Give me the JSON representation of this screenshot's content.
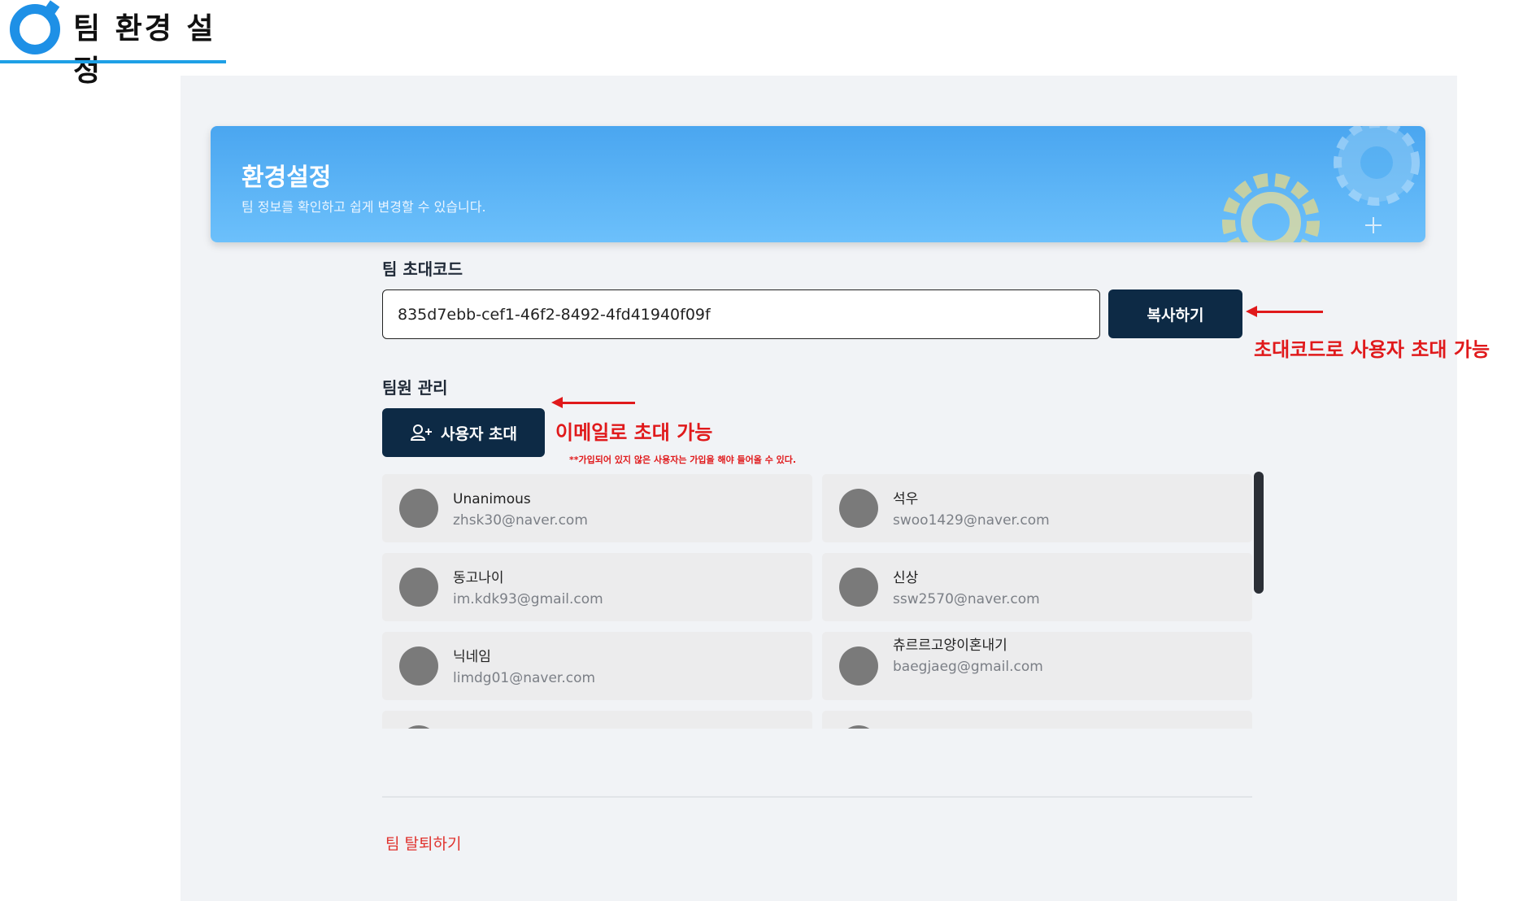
{
  "doc_heading": {
    "title": "팀 환경 설정"
  },
  "banner": {
    "title": "환경설정",
    "subtitle": "팀 정보를 확인하고 쉽게 변경할 수 있습니다."
  },
  "invite_code": {
    "label": "팀 초대코드",
    "value": "835d7ebb-cef1-46f2-8492-4fd41940f09f",
    "copy_label": "복사하기"
  },
  "members": {
    "label": "팀원 관리",
    "invite_button_label": "사용자 초대",
    "invite_icon": "user-plus-icon",
    "list": [
      {
        "name": "Unanimous",
        "email": "zhsk30@naver.com"
      },
      {
        "name": "석우",
        "email": "swoo1429@naver.com"
      },
      {
        "name": "동고나이",
        "email": "im.kdk93@gmail.com"
      },
      {
        "name": "신상",
        "email": "ssw2570@naver.com"
      },
      {
        "name": "닉네임",
        "email": "limdg01@naver.com"
      },
      {
        "name": "츄르르고양이혼내기",
        "email": "baegjaeg@gmail.com"
      }
    ]
  },
  "leave_team_label": "팀 탈퇴하기",
  "annotations": {
    "code_note": "초대코드로 사용자 초대 가능",
    "email_note": "이메일로 초대 가능",
    "email_subnote": "**가입되어 있지 않은 사용자는 가입을 해야 들어올 수 있다."
  },
  "colors": {
    "accent_blue": "#1e90e6",
    "banner_blue": "#4aa6f0",
    "dark_button": "#0d2a45",
    "annotation_red": "#e0191b",
    "leave_red": "#e0322d"
  }
}
